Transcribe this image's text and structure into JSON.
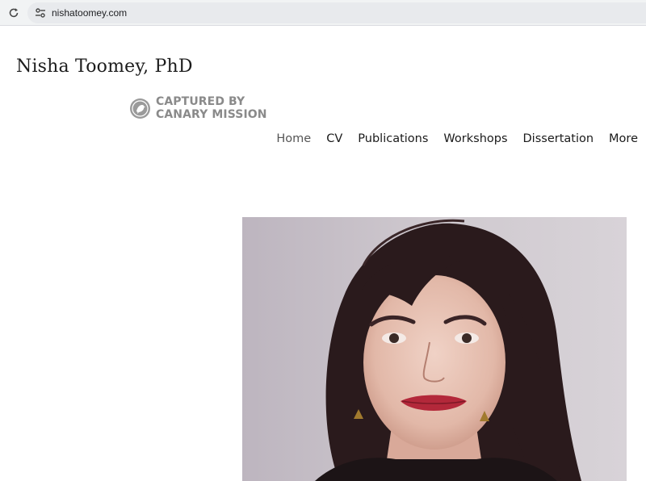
{
  "browser": {
    "url": "nishatoomey.com",
    "reload_icon": "reload-icon",
    "site_info_icon": "tune-icon"
  },
  "site": {
    "title": "Nisha Toomey, PhD"
  },
  "badge": {
    "line1": "CAPTURED BY",
    "line2": "CANARY MISSION",
    "icon": "canary-bird-icon",
    "color": "#8a8a8a"
  },
  "nav": {
    "items": [
      {
        "label": "Home",
        "active": true
      },
      {
        "label": "CV"
      },
      {
        "label": "Publications"
      },
      {
        "label": "Workshops"
      },
      {
        "label": "Dissertation"
      },
      {
        "label": "More"
      }
    ]
  },
  "hero": {
    "image": "portrait-photo",
    "background_color": "#c9c3c9"
  }
}
